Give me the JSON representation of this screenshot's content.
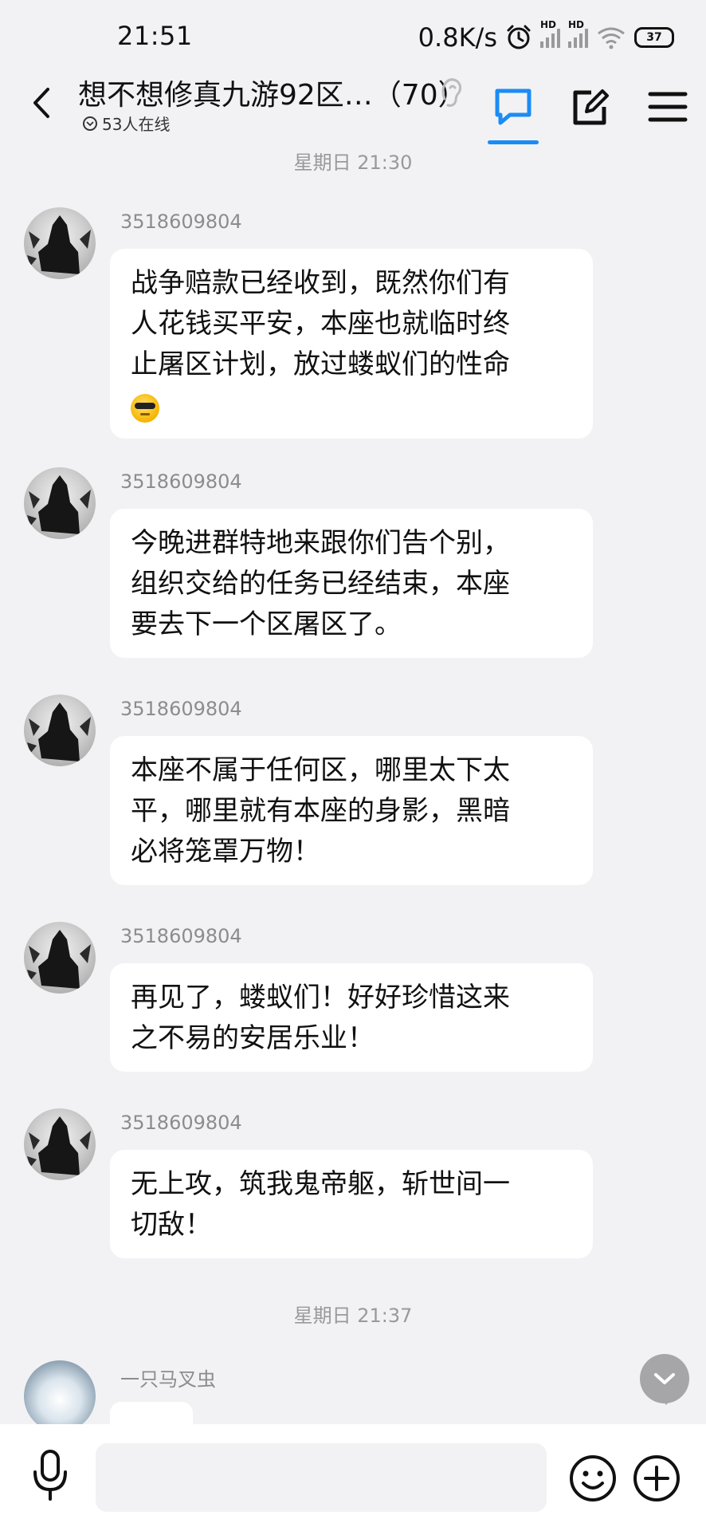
{
  "status_bar": {
    "time": "21:51",
    "net_speed": "0.8K/s",
    "sig1_label": "HD",
    "sig2_label": "HD",
    "battery": "37"
  },
  "header": {
    "title": "想不想修真九游92区…（70）",
    "online_text": "53人在线",
    "accent_color": "#1a8cf5"
  },
  "divider1": "星期日 21:30",
  "divider2": "星期日 21:37",
  "messages": [
    {
      "sender": "3518609804",
      "lines": [
        "战争赔款已经收到，既然你们有",
        "人花钱买平安，本座也就临时终",
        "止屠区计划，放过蝼蚁们的性命"
      ],
      "emoji": "cool-sunglasses-emoji"
    },
    {
      "sender": "3518609804",
      "lines": [
        "今晚进群特地来跟你们告个别，",
        "组织交给的任务已经结束，本座",
        "要去下一个区屠区了。"
      ]
    },
    {
      "sender": "3518609804",
      "lines": [
        "本座不属于任何区，哪里太下太",
        "平，哪里就有本座的身影，黑暗",
        "必将笼罩万物！"
      ]
    },
    {
      "sender": "3518609804",
      "lines": [
        "再见了，蝼蚁们！好好珍惜这来",
        "之不易的安居乐业！"
      ]
    },
    {
      "sender": "3518609804",
      "lines": [
        "无上攻，筑我鬼帝躯，斩世间一",
        "切敌！"
      ]
    },
    {
      "sender": "一只马叉虫",
      "lines": []
    }
  ],
  "input": {
    "value": "",
    "placeholder": ""
  },
  "icons": {
    "back": "back-arrow-icon",
    "ear": "ear-icon",
    "chat": "chat-icon",
    "edit": "edit-icon",
    "menu": "menu-icon",
    "mic": "microphone-icon",
    "emoji": "smiley-icon",
    "plus": "plus-icon",
    "scroll": "chevron-down-icon"
  }
}
